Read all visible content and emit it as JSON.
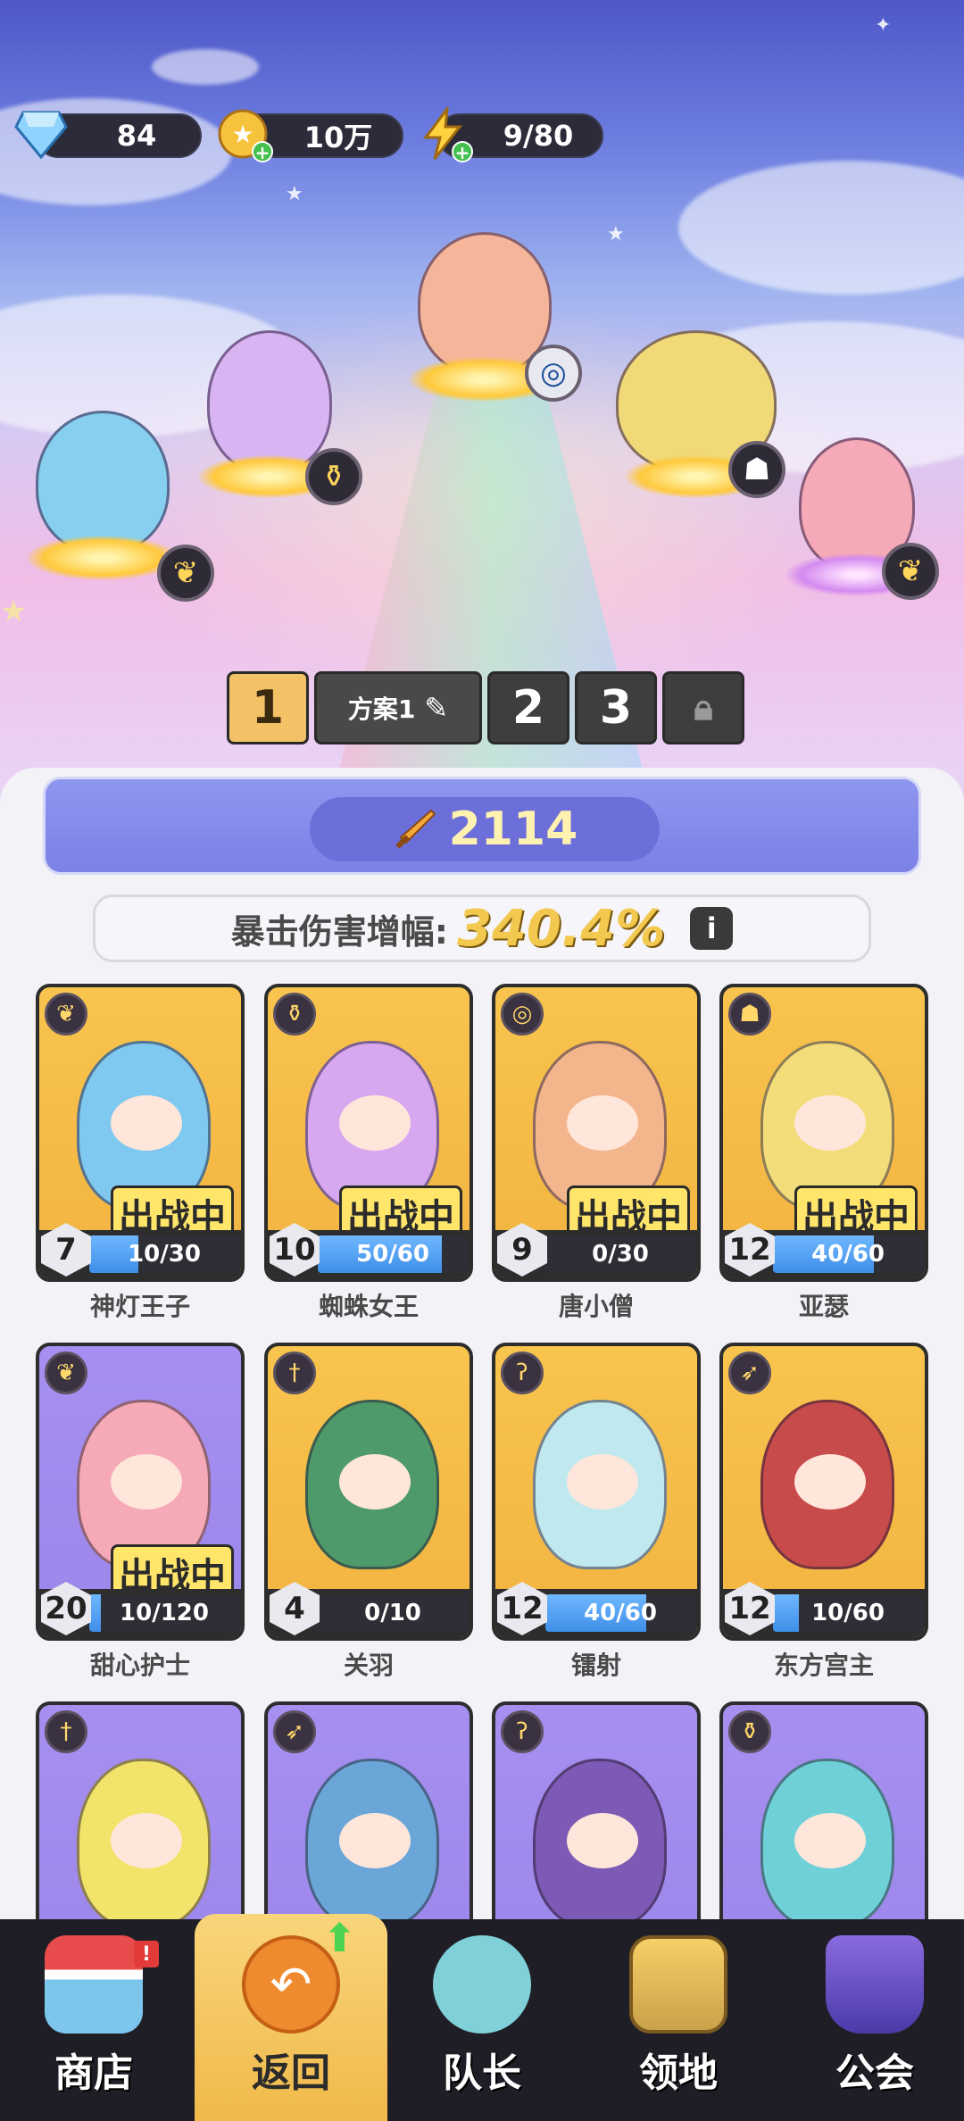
{
  "hud": {
    "gems": "84",
    "coins": "10万",
    "energy": "9/80"
  },
  "formation_tabs": {
    "tab1": "1",
    "scheme_name": "方案1",
    "tab2": "2",
    "tab3": "3"
  },
  "power": "2114",
  "crit": {
    "label": "暴击伤害增幅:",
    "value": "340.4%"
  },
  "deploy_label": "出战中",
  "cards": [
    {
      "name": "神灯王子",
      "level": "7",
      "progress": "10/30",
      "fill": 0.33,
      "deployed": true,
      "frame": "gold",
      "class_icon": "wings-icon",
      "color": "#7fc8ef"
    },
    {
      "name": "蜘蛛女王",
      "level": "10",
      "progress": "50/60",
      "fill": 0.83,
      "deployed": true,
      "frame": "gold",
      "class_icon": "potion-icon",
      "color": "#d7a7f0"
    },
    {
      "name": "唐小僧",
      "level": "9",
      "progress": "0/30",
      "fill": 0.0,
      "deployed": true,
      "frame": "gold",
      "class_icon": "spiral-icon",
      "color": "#f3b58c"
    },
    {
      "name": "亚瑟",
      "level": "12",
      "progress": "40/60",
      "fill": 0.67,
      "deployed": true,
      "frame": "gold",
      "class_icon": "helmet-icon",
      "color": "#f2dd7a"
    },
    {
      "name": "甜心护士",
      "level": "20",
      "progress": "10/120",
      "fill": 0.08,
      "deployed": true,
      "frame": "purple",
      "class_icon": "wings-icon",
      "color": "#f6a9b6"
    },
    {
      "name": "关羽",
      "level": "4",
      "progress": "0/10",
      "fill": 0.0,
      "deployed": false,
      "frame": "gold",
      "class_icon": "sword-icon",
      "color": "#4f9a6a"
    },
    {
      "name": "镭射",
      "level": "12",
      "progress": "40/60",
      "fill": 0.67,
      "deployed": false,
      "frame": "gold",
      "class_icon": "scythe-icon",
      "color": "#bfe9ee"
    },
    {
      "name": "东方宫主",
      "level": "12",
      "progress": "10/60",
      "fill": 0.17,
      "deployed": false,
      "frame": "gold",
      "class_icon": "bow-icon",
      "color": "#c74b4b"
    },
    {
      "name": "",
      "level": "",
      "progress": "",
      "fill": 0,
      "deployed": false,
      "frame": "purple",
      "class_icon": "sword-icon",
      "color": "#f2e36a"
    },
    {
      "name": "",
      "level": "",
      "progress": "",
      "fill": 0,
      "deployed": false,
      "frame": "purple",
      "class_icon": "bow-icon",
      "color": "#6aa6d8"
    },
    {
      "name": "",
      "level": "",
      "progress": "",
      "fill": 0,
      "deployed": false,
      "frame": "purple",
      "class_icon": "scythe-icon",
      "color": "#7d5ab5"
    },
    {
      "name": "",
      "level": "",
      "progress": "",
      "fill": 0,
      "deployed": false,
      "frame": "purple",
      "class_icon": "potion-icon",
      "color": "#6fd0d8"
    }
  ],
  "nav": {
    "shop": "商店",
    "back": "返回",
    "captain": "队长",
    "territory": "领地",
    "guild": "公会"
  },
  "colors": {
    "gold_frame": "#f8c44e",
    "purple_frame": "#a68ff0",
    "power_bar": "#8f96ef",
    "nav_active": "#f9d57a"
  }
}
